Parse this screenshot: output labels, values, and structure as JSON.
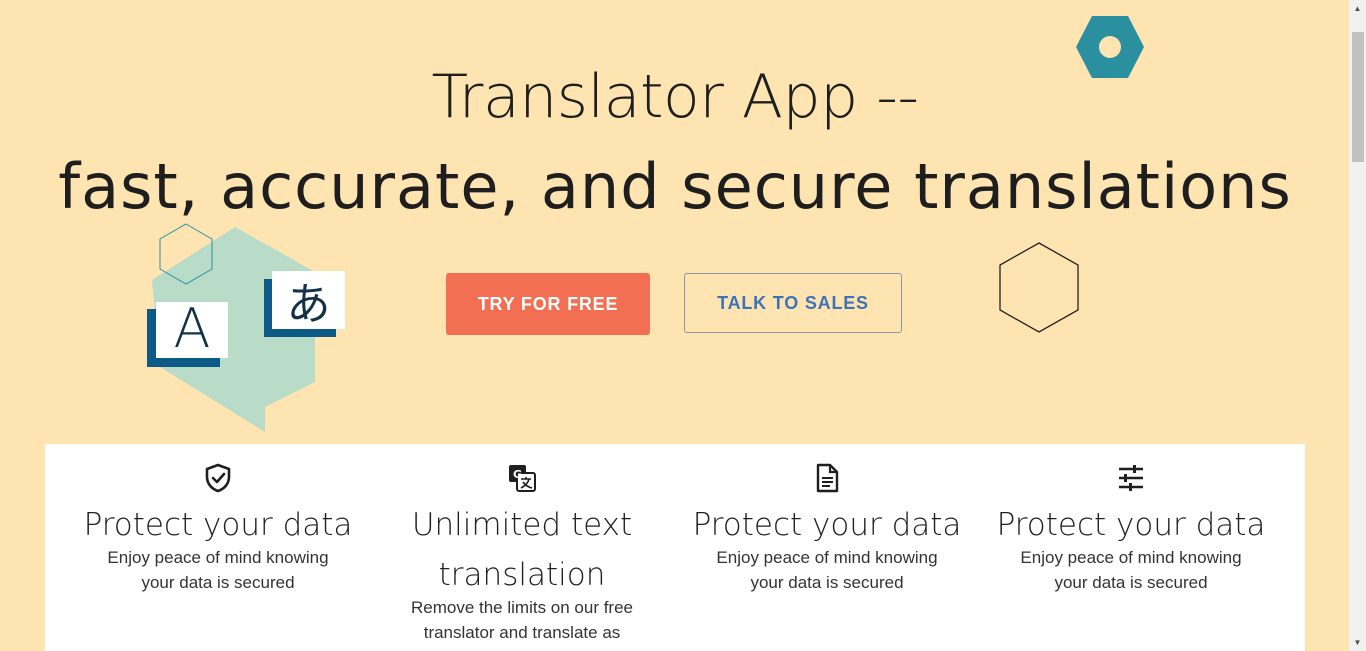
{
  "hero": {
    "title_line1": "Translator App --",
    "title_line2": "fast, accurate, and secure translations",
    "primary_button": "TRY FOR FREE",
    "secondary_button": "TALK TO SALES",
    "illustration": {
      "latin_glyph": "A",
      "japanese_glyph": "あ"
    }
  },
  "features": [
    {
      "icon": "shield-check-icon",
      "title": "Protect your data",
      "description": "Enjoy peace of mind knowing your data is secured"
    },
    {
      "icon": "translate-icon",
      "title": "Unlimited text translation",
      "description": "Remove the limits on our free translator and translate as much as"
    },
    {
      "icon": "document-icon",
      "title": "Protect your data",
      "description": "Enjoy peace of mind knowing your data is secured"
    },
    {
      "icon": "sliders-icon",
      "title": "Protect your data",
      "description": "Enjoy peace of mind knowing your data is secured"
    }
  ],
  "colors": {
    "background": "#fde4b1",
    "primary_button": "#f36f54",
    "secondary_text": "#3e73b8",
    "hex_teal": "#2a90a0",
    "bubble_green": "#b9dcc8",
    "glyph_navy": "#0d5a87"
  }
}
